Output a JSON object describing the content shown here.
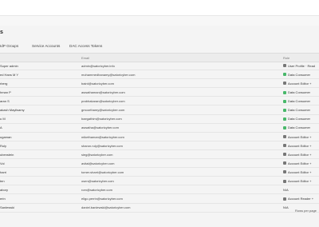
{
  "page": {
    "title": "s"
  },
  "tabs": [
    "IdP Groups",
    "Service Accounts",
    "DAC Access Tokens"
  ],
  "table": {
    "columns": {
      "email": "Email",
      "role": "Role"
    },
    "rows": [
      {
        "name": "Super admin",
        "email": "admin@satoricyber.info",
        "role": "User Profile · Read",
        "icon": "person"
      },
      {
        "name": "ed Hans M Y",
        "email": "mohammedhanamy@satoricyber.com",
        "role": "Data Consumer",
        "icon": "data"
      },
      {
        "name": "rberg",
        "email": "baird@satoricyber.com",
        "role": "Account Editor +",
        "icon": "person"
      },
      {
        "name": "hman P",
        "email": "aswathaman@satoricyber.com",
        "role": "Data Consumer",
        "icon": "data"
      },
      {
        "name": "aran S",
        "email": "prabhakaran@satoricyber.com",
        "role": "Data Consumer",
        "icon": "data"
      },
      {
        "name": "akash Mayilsamy",
        "email": "gmoorthamy@satoricyber.com",
        "role": "Data Consumer",
        "icon": "data"
      },
      {
        "name": "u M",
        "email": "baegathim@satoricyber.com",
        "role": "Data Consumer",
        "icon": "data"
      },
      {
        "name": "A",
        "email": "aswatha@satoricyber.com",
        "role": "Data Consumer",
        "icon": "data"
      },
      {
        "name": "ugaman",
        "email": "mikethaman@satoricyber.com",
        "role": "Account Editor +",
        "icon": "person"
      },
      {
        "name": "Ruly",
        "email": "sharon.ruly@satoricyber.com",
        "role": "Account Editor +",
        "icon": "person"
      },
      {
        "name": "ubenstein",
        "email": "sieg@satoricyber.com",
        "role": "Account Editor +",
        "icon": "person"
      },
      {
        "name": "Vol",
        "email": "avital@satoricyber.com",
        "role": "Account Editor +",
        "icon": "person"
      },
      {
        "name": "harri",
        "email": "tomer.sharri@satoricyber.com",
        "role": "Account Editor +",
        "icon": "person"
      },
      {
        "name": "ten",
        "email": "osen@satoricyber.com",
        "role": "Account Editor +",
        "icon": "person"
      },
      {
        "name": "abory",
        "email": "rom@satoricyber.com",
        "role": "N/A",
        "icon": "none"
      },
      {
        "name": "erin",
        "email": "eligo.perrin@satoricyber.com",
        "role": "Account Reader +",
        "icon": "person"
      },
      {
        "name": "Sanlewski",
        "email": "daniel.banlewski@satoricyber.com",
        "role": "N/A",
        "icon": "none"
      }
    ]
  },
  "pager": {
    "label": "Rows per page"
  }
}
